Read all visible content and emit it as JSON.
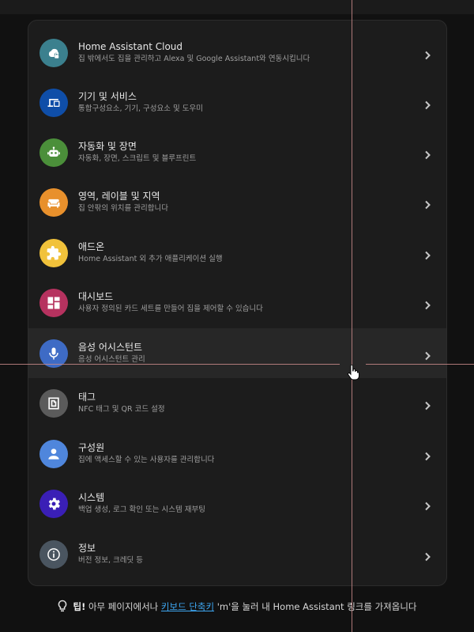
{
  "menu": {
    "items": [
      {
        "title": "Home Assistant Cloud",
        "subtitle": "집 밖에서도 집을 관리하고 Alexa 및 Google Assistant와 연동시킵니다",
        "color": "#3b808e",
        "icon": "cloud-lock-icon"
      },
      {
        "title": "기기 및 서비스",
        "subtitle": "통합구성요소, 기기, 구성요소 및 도우미",
        "color": "#0f4ea8",
        "icon": "devices-icon"
      },
      {
        "title": "자동화 및 장면",
        "subtitle": "자동화, 장면, 스크립트 및 블루프린트",
        "color": "#4b8f3a",
        "icon": "robot-icon"
      },
      {
        "title": "영역, 레이블 및 지역",
        "subtitle": "집 안팎의 위치를 관리합니다",
        "color": "#e8902c",
        "icon": "sofa-icon"
      },
      {
        "title": "애드온",
        "subtitle": "Home Assistant 외 추가 애플리케이션 실행",
        "color": "#f1c23b",
        "icon": "puzzle-icon"
      },
      {
        "title": "대시보드",
        "subtitle": "사용자 정의된 카드 세트를 만들어 집을 제어할 수 있습니다",
        "color": "#b6325f",
        "icon": "dashboard-icon"
      },
      {
        "title": "음성 어시스턴트",
        "subtitle": "음성 어시스턴트 관리",
        "color": "#3e6bc5",
        "icon": "microphone-icon"
      },
      {
        "title": "태그",
        "subtitle": "NFC 태그 및 QR 코드 설정",
        "color": "#5b5b5b",
        "icon": "nfc-tag-icon"
      },
      {
        "title": "구성원",
        "subtitle": "집에 액세스할 수 있는 사용자를 관리합니다",
        "color": "#4f86dc",
        "icon": "account-icon"
      },
      {
        "title": "시스템",
        "subtitle": "백업 생성, 로그 확인 또는 시스템 재부팅",
        "color": "#3a1fb6",
        "icon": "cog-icon"
      },
      {
        "title": "정보",
        "subtitle": "버전 정보, 크레딧 등",
        "color": "#4a5560",
        "icon": "info-icon"
      }
    ]
  },
  "tip": {
    "label": "팁!",
    "before": "아무 페이지에서나",
    "link": "키보드 단축키",
    "after": "'m'을 눌러 내 Home Assistant 링크를 가져옵니다"
  }
}
